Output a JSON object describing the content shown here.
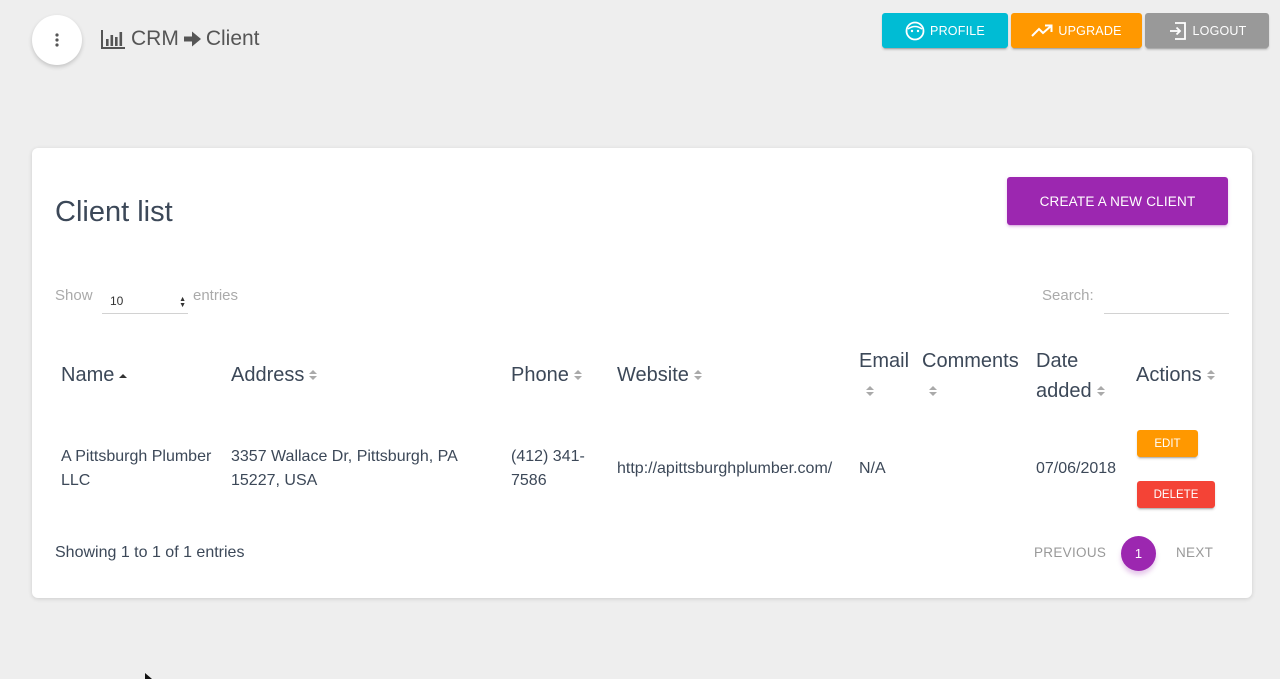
{
  "header": {
    "app_name": "CRM",
    "page_name": "Client"
  },
  "nav": {
    "profile_label": "PROFILE",
    "upgrade_label": "UPGRADE",
    "logout_label": "LOGOUT"
  },
  "card": {
    "title": "Client list",
    "create_label": "CREATE A NEW CLIENT"
  },
  "controls": {
    "show_label": "Show",
    "entries_label": "entries",
    "page_length": "10",
    "search_label": "Search:",
    "search_value": ""
  },
  "table": {
    "columns": [
      "Name",
      "Address",
      "Phone",
      "Website",
      "Email",
      "Comments",
      "Date added",
      "Actions"
    ],
    "sorted_column": "Name",
    "sort_direction": "ascending",
    "rows": [
      {
        "name": "A Pittsburgh Plumber LLC",
        "address": "3357 Wallace Dr, Pittsburgh, PA 15227, USA",
        "phone": "(412) 341-7586",
        "website": "http://apittsburghplumber.com/",
        "email": "N/A",
        "comments": "",
        "date_added": "07/06/2018",
        "edit_label": "EDIT",
        "delete_label": "DELETE"
      }
    ]
  },
  "footer": {
    "info": "Showing 1 to 1 of 1 entries",
    "previous_label": "PREVIOUS",
    "current_page": "1",
    "next_label": "NEXT"
  },
  "colors": {
    "profile": "#00bcd4",
    "upgrade": "#ff9800",
    "logout": "#999999",
    "primary": "#9c27b0",
    "edit": "#ff9800",
    "delete": "#f44336"
  }
}
